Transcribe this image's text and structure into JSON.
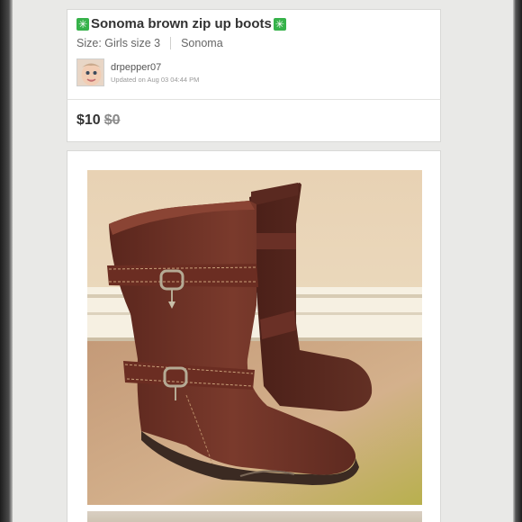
{
  "listing": {
    "title": "Sonoma brown zip up boots",
    "title_emoji": "sparkle-emoji",
    "size": "Size: Girls size 3",
    "brand": "Sonoma",
    "seller": {
      "username": "drpepper07",
      "updated": "Updated on Aug 03 04:44 PM"
    },
    "price": "$10",
    "original_price": "$0"
  },
  "colors": {
    "background": "#e9e9e7",
    "card": "#ffffff",
    "sparkle": "#36b24a",
    "boot": "#6e3226"
  }
}
